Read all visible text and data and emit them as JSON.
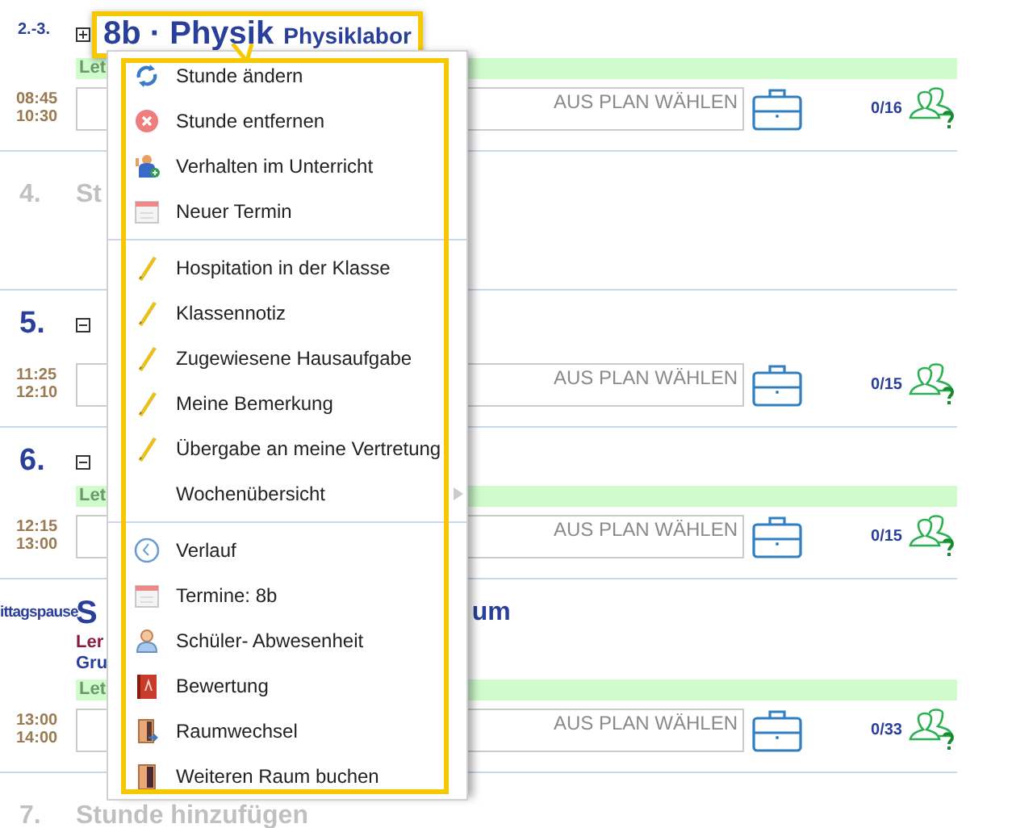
{
  "lessons": [
    {
      "kind": "double",
      "period": "2.-3.",
      "expanded": false,
      "title": "8b · Physik",
      "room": "Physiklabor",
      "highlighted": true,
      "note": "Let",
      "start": "08:45",
      "end": "10:30",
      "placeholder": "AUS PLAN WÄHLEN",
      "attendance": "0/16"
    },
    {
      "kind": "empty",
      "period": "4.",
      "title": "St"
    },
    {
      "kind": "lesson",
      "period": "5.",
      "expanded": true,
      "start": "11:25",
      "end": "12:10",
      "placeholder": "AUS PLAN WÄHLEN",
      "attendance": "0/15"
    },
    {
      "kind": "lesson",
      "period": "6.",
      "expanded": true,
      "note": "Let",
      "start": "12:15",
      "end": "13:00",
      "placeholder": "AUS PLAN WÄHLEN",
      "attendance": "0/15"
    },
    {
      "kind": "break",
      "period": "ittagspause",
      "title": "S",
      "room": "um",
      "lines": [
        {
          "text": "Ler",
          "color": "#8a1c3c"
        },
        {
          "text": "Gru",
          "color": "#2a3f9a"
        }
      ],
      "note": "Let",
      "start": "13:00",
      "end": "14:00",
      "placeholder": "AUS PLAN WÄHLEN",
      "attendance": "0/33"
    },
    {
      "kind": "empty",
      "period": "7.",
      "title": "Stunde hinzufügen"
    }
  ],
  "menu": {
    "highlighted": true,
    "sections": [
      {
        "items": [
          {
            "label": "Stunde ändern",
            "has_submenu": false
          },
          {
            "label": "Stunde entfernen",
            "has_submenu": false
          },
          {
            "label": "Verhalten im Unterricht",
            "has_submenu": false
          },
          {
            "label": "Neuer Termin",
            "has_submenu": false
          }
        ]
      },
      {
        "items": [
          {
            "label": "Hospitation in der Klasse",
            "has_submenu": false
          },
          {
            "label": "Klassennotiz",
            "has_submenu": false
          },
          {
            "label": "Zugewiesene Hausaufgabe",
            "has_submenu": false
          },
          {
            "label": "Meine Bemerkung",
            "has_submenu": false
          },
          {
            "label": "Übergabe an meine Vertretung",
            "has_submenu": false
          },
          {
            "label": "Wochenübersicht",
            "has_submenu": true
          }
        ]
      },
      {
        "items": [
          {
            "label": "Verlauf",
            "has_submenu": false
          },
          {
            "label": "Termine: 8b",
            "has_submenu": false
          },
          {
            "label": "Schüler- Abwesenheit",
            "has_submenu": false
          },
          {
            "label": "Bewertung",
            "has_submenu": false
          },
          {
            "label": "Raumwechsel",
            "has_submenu": false
          },
          {
            "label": "Weiteren Raum buchen",
            "has_submenu": false
          }
        ]
      }
    ]
  }
}
